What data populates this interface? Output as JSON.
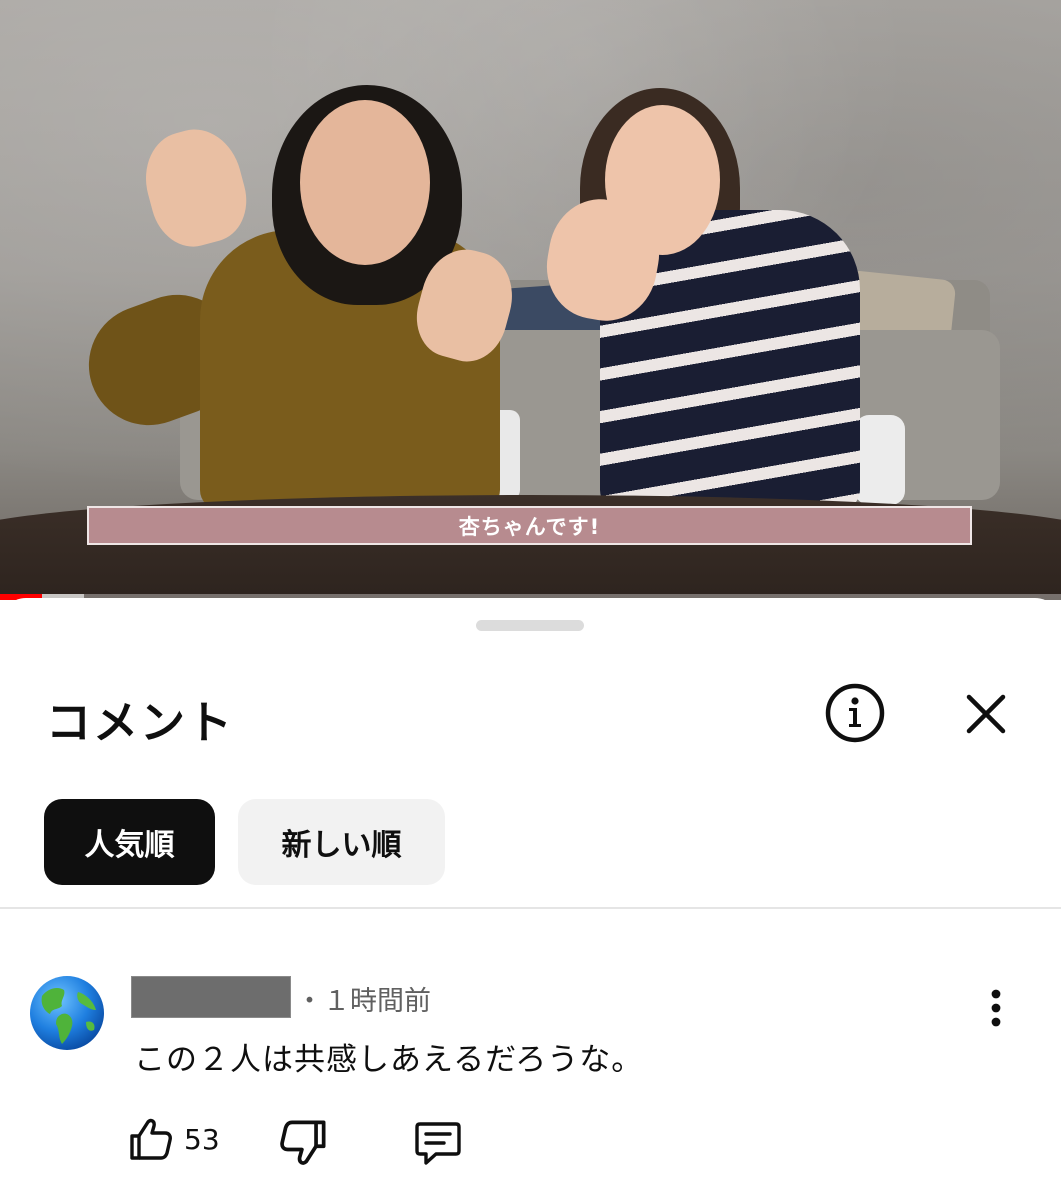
{
  "video": {
    "subtitle": "杏ちゃんです!",
    "progress": 0.04,
    "buffered": 0.04
  },
  "sheet": {
    "title": "コメント",
    "info_icon": "info-circle-icon",
    "close_icon": "close-icon"
  },
  "sort": {
    "chips": [
      {
        "label": "人気順",
        "active": true
      },
      {
        "label": "新しい順",
        "active": false
      }
    ]
  },
  "comment": {
    "avatar_icon": "globe-icon",
    "time": "・１時間前",
    "text": "この２人は共感しあえるだろうな。",
    "likes": "53",
    "more_icon": "more-vertical-icon",
    "like_icon": "thumbs-up-icon",
    "dislike_icon": "thumbs-down-icon",
    "reply_icon": "reply-icon"
  },
  "colors": {
    "accent_red": "#ff0000",
    "chip_active_bg": "#0f0f0f",
    "chip_inactive_bg": "#f2f2f2",
    "subtitle_bg": "#b78b8f"
  }
}
